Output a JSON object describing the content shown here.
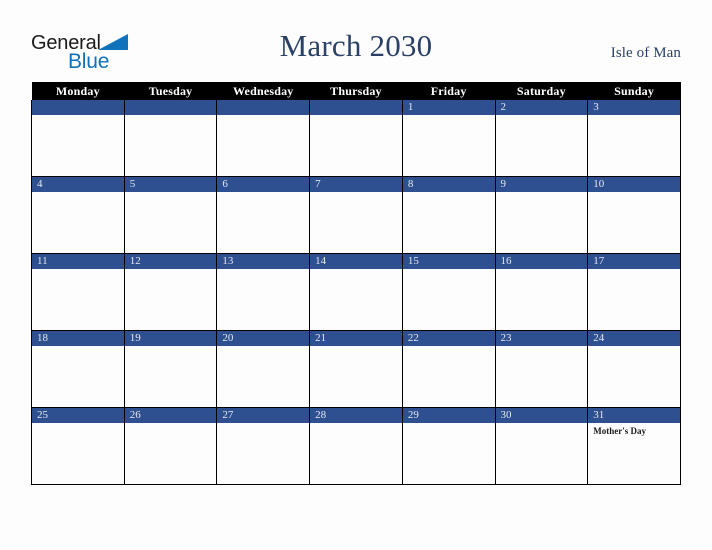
{
  "brand": {
    "name_part1": "General",
    "name_part2": "Blue",
    "triangle_icon": "triangle-icon",
    "color_black": "#1b1b1b",
    "color_blue": "#1072ba"
  },
  "header": {
    "title": "March 2030",
    "location": "Isle of Man",
    "title_color": "#2b4066"
  },
  "theme": {
    "header_row_bg": "#000000",
    "header_row_text": "#ffffff",
    "date_band_bg": "#2e5090",
    "date_band_text": "#e4e8f0",
    "cell_bg": "#fdfdfd",
    "grid_line": "#000000",
    "page_bg": "#fdfdfd"
  },
  "calendar": {
    "month": "March",
    "year": "2030",
    "weekday_headers": [
      "Monday",
      "Tuesday",
      "Wednesday",
      "Thursday",
      "Friday",
      "Saturday",
      "Sunday"
    ],
    "weeks": [
      [
        {
          "date": "",
          "events": []
        },
        {
          "date": "",
          "events": []
        },
        {
          "date": "",
          "events": []
        },
        {
          "date": "",
          "events": []
        },
        {
          "date": "1",
          "events": []
        },
        {
          "date": "2",
          "events": []
        },
        {
          "date": "3",
          "events": []
        }
      ],
      [
        {
          "date": "4",
          "events": []
        },
        {
          "date": "5",
          "events": []
        },
        {
          "date": "6",
          "events": []
        },
        {
          "date": "7",
          "events": []
        },
        {
          "date": "8",
          "events": []
        },
        {
          "date": "9",
          "events": []
        },
        {
          "date": "10",
          "events": []
        }
      ],
      [
        {
          "date": "11",
          "events": []
        },
        {
          "date": "12",
          "events": []
        },
        {
          "date": "13",
          "events": []
        },
        {
          "date": "14",
          "events": []
        },
        {
          "date": "15",
          "events": []
        },
        {
          "date": "16",
          "events": []
        },
        {
          "date": "17",
          "events": []
        }
      ],
      [
        {
          "date": "18",
          "events": []
        },
        {
          "date": "19",
          "events": []
        },
        {
          "date": "20",
          "events": []
        },
        {
          "date": "21",
          "events": []
        },
        {
          "date": "22",
          "events": []
        },
        {
          "date": "23",
          "events": []
        },
        {
          "date": "24",
          "events": []
        }
      ],
      [
        {
          "date": "25",
          "events": []
        },
        {
          "date": "26",
          "events": []
        },
        {
          "date": "27",
          "events": []
        },
        {
          "date": "28",
          "events": []
        },
        {
          "date": "29",
          "events": []
        },
        {
          "date": "30",
          "events": []
        },
        {
          "date": "31",
          "events": [
            "Mother's Day"
          ]
        }
      ]
    ]
  }
}
